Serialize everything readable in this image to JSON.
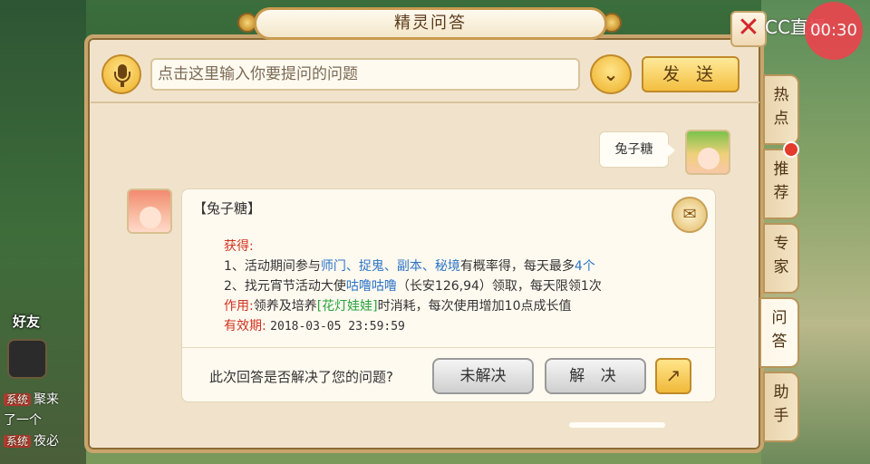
{
  "window": {
    "title": "精灵问答"
  },
  "overlay": {
    "watermark": "CC直播",
    "record_time": "00:30"
  },
  "input": {
    "placeholder": "点击这里输入你要提问的问题",
    "send_label": "发 送"
  },
  "conversation": {
    "user_question": "兔子糖",
    "answer": {
      "title": "【兔子糖】",
      "obtain_label": "获得:",
      "line1_prefix": "1、活动期间参与",
      "line1_links": "师门、捉鬼、副本、秘境",
      "line1_middle": "有概率得，每天最多",
      "line1_count": "4个",
      "line2_prefix": "2、找元宵节活动大使",
      "line2_npc": "咕噜咕噜",
      "line2_suffix": "（长安126,94）领取，每天限领1次",
      "use_label": "作用:",
      "use_prefix": "领养及培养",
      "use_item": "[花灯娃娃]",
      "use_suffix": "时消耗，每次使用增加10点成长值",
      "expiry_label": "有效期:",
      "expiry_value": "2018-03-05 23:59:59"
    },
    "feedback_question": "此次回答是否解决了您的问题?",
    "unresolved_label": "未解决",
    "resolved_label": "解 决"
  },
  "side_tabs": [
    {
      "label": "热点"
    },
    {
      "label": "推荐"
    },
    {
      "label": "专家"
    },
    {
      "label": "问答",
      "active": true
    },
    {
      "label": "助手"
    }
  ],
  "hud": {
    "friends_label": "好友",
    "chat": [
      {
        "tag": "系统",
        "text": "聚来"
      },
      {
        "tag": "",
        "text": "了一个"
      },
      {
        "tag": "系统",
        "text": "夜必"
      }
    ]
  },
  "colors": {
    "highlight_red": "#d0321e",
    "link_blue": "#2b74c7",
    "item_green": "#27a33b",
    "panel_bg": "#f1e3cb"
  },
  "icons": [
    "mic-icon",
    "chevron-down-icon",
    "close-icon",
    "share-icon",
    "scroll-icon"
  ]
}
